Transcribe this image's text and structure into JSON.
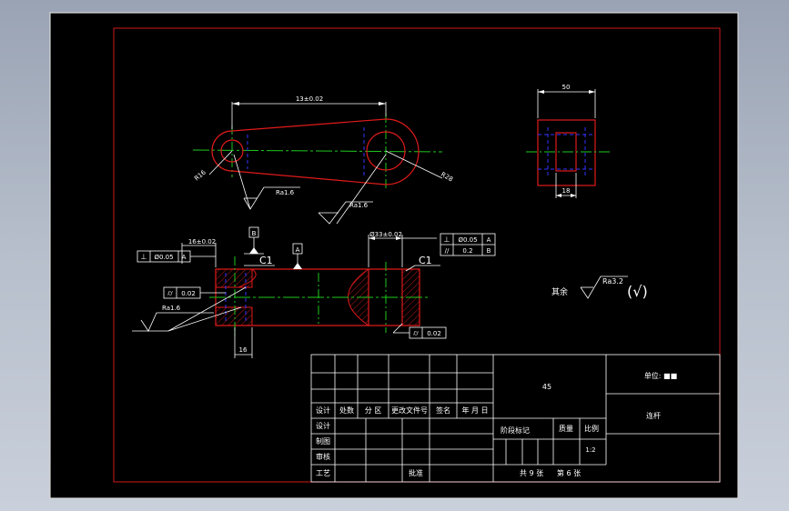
{
  "colors": {
    "background": "#000000",
    "frame": "#d01818",
    "outline": "#e01a1a",
    "centerline": "#1ec81e",
    "hidden": "#3434ff",
    "annotation": "#ffffff"
  },
  "top_view": {
    "dim_length": "13±0.02",
    "radius_left": "R16",
    "radius_right": "R28",
    "roughness_left": "Ra1.6",
    "roughness_right": "Ra1.6"
  },
  "side_view": {
    "dim_width": "50",
    "dim_slot": "18"
  },
  "front_view": {
    "dim_offset": "16±0.02",
    "datum_b": "B",
    "datum_a": "A",
    "chamfer_left": "C1",
    "chamfer_right": "C1",
    "dim_bore": "Ø33±0.02",
    "fcf_left_perp": "⊥",
    "fcf_left_value": "Ø0.05",
    "fcf_left_datum": "A",
    "fcf_right_perp": "⊥",
    "fcf_right_value": "Ø0.05",
    "fcf_right_datum": "A",
    "fcf_parallel_symbol": "//",
    "fcf_parallel_value": "0.2",
    "fcf_parallel_datum": "B",
    "cyl_left_symbol": "⌭",
    "cyl_left_value": "0.02",
    "cyl_bottom_symbol": "⌭",
    "cyl_bottom_value": "0.02",
    "roughness": "Ra1.6",
    "dim_bottom": "16"
  },
  "general_roughness": {
    "label": "其余",
    "value": "Ra3.2",
    "check": "(√)"
  },
  "title_block": {
    "header_row": [
      "设计",
      "处数",
      "分  区",
      "更改文件号",
      "签名",
      "年  月  日"
    ],
    "left_labels": [
      "设计",
      "制图",
      "审核",
      "工艺"
    ],
    "approve": "批准",
    "material": "45",
    "unit_label": "单位: ■■",
    "stage_label": "阶段标记",
    "weight_label": "质量",
    "scale_label": "比例",
    "scale_value": "1:2",
    "part_name": "连杆",
    "sheets": "共 9 张",
    "sheet_no": "第 6 张"
  }
}
